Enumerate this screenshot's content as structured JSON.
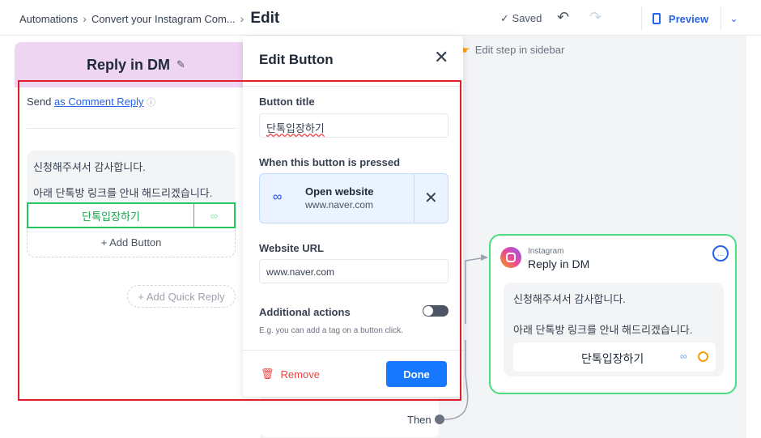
{
  "breadcrumb": {
    "root": "Automations",
    "flow": "Convert your Instagram Com...",
    "current": "Edit"
  },
  "toolbar": {
    "saved_label": "Saved",
    "preview_label": "Preview"
  },
  "canvas": {
    "edit_hint": "Edit step in sidebar",
    "then_label": "Then"
  },
  "step": {
    "title": "Reply in DM",
    "send_prefix": "Send",
    "send_mode": "as Comment Reply",
    "message_line1": "신청해주셔서 감사합니다.",
    "message_line2": "아래 단톡방 링크를 안내 해드리겠습니다.",
    "button_label": "단톡입장하기",
    "add_button_label": "+ Add Button",
    "add_quick_reply_label": "+ Add Quick Reply"
  },
  "modal": {
    "title": "Edit Button",
    "button_title_label": "Button title",
    "button_title_value": "단톡입장하기",
    "when_pressed_label": "When this button is pressed",
    "action_title": "Open website",
    "action_subtitle": "www.naver.com",
    "website_url_label": "Website URL",
    "website_url_value": "www.naver.com",
    "additional_label": "Additional actions",
    "additional_hint": "E.g. you can add a tag on a button click.",
    "additional_enabled": false,
    "remove_label": "Remove",
    "done_label": "Done"
  },
  "node": {
    "source": "Instagram",
    "title": "Reply in DM",
    "message_line1": "신청해주셔서 감사합니다.",
    "message_line2": "아래 단톡방 링크를 안내 해드리겠습니다.",
    "button_label": "단톡입장하기"
  },
  "colors": {
    "accent": "#1677ff",
    "step_header": "#eed6f3",
    "highlight": "#e11d2a",
    "node_border": "#4ade80"
  }
}
